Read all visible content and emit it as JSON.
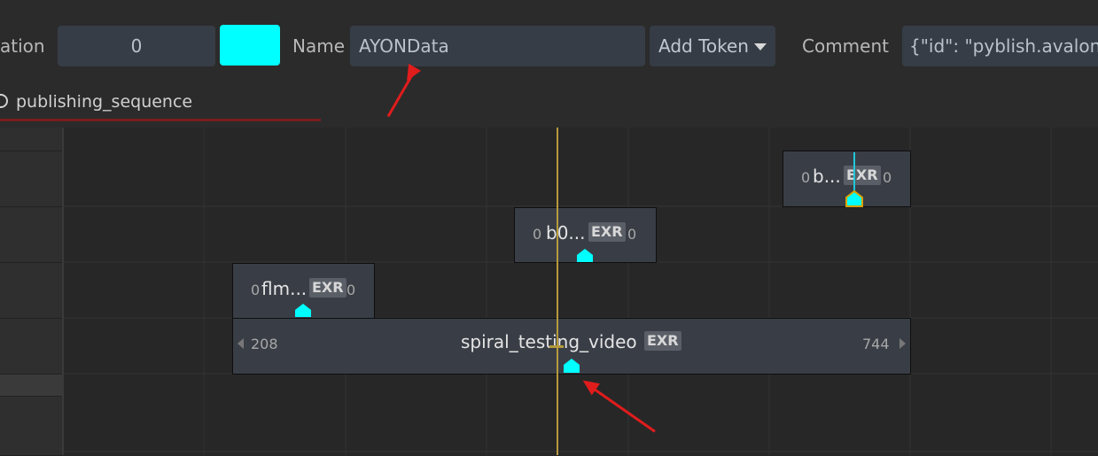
{
  "toolbar": {
    "partial_label": "ation",
    "index_value": "0",
    "swatch_color": "#00ffff",
    "name_label": "Name",
    "name_value": "AYONData",
    "add_token_label": "Add Token",
    "comment_label": "Comment",
    "comment_value": "{\"id\": \"pyblish.avalon.i"
  },
  "sequence": {
    "name": "publishing_sequence"
  },
  "clips": [
    {
      "name": "b...",
      "left_count": "0",
      "right_count": "0",
      "badge": "EXR"
    },
    {
      "name": "b0...",
      "left_count": "0",
      "right_count": "0",
      "badge": "EXR"
    },
    {
      "name": "flm...",
      "left_count": "0",
      "right_count": "0",
      "badge": "EXR"
    },
    {
      "name": "spiral_testing_video",
      "start": "208",
      "end": "744",
      "badge": "EXR"
    }
  ],
  "colors": {
    "marker": "#00ffff",
    "playhead": "#b59a3c",
    "annotation_arrow": "#e01c1c"
  }
}
